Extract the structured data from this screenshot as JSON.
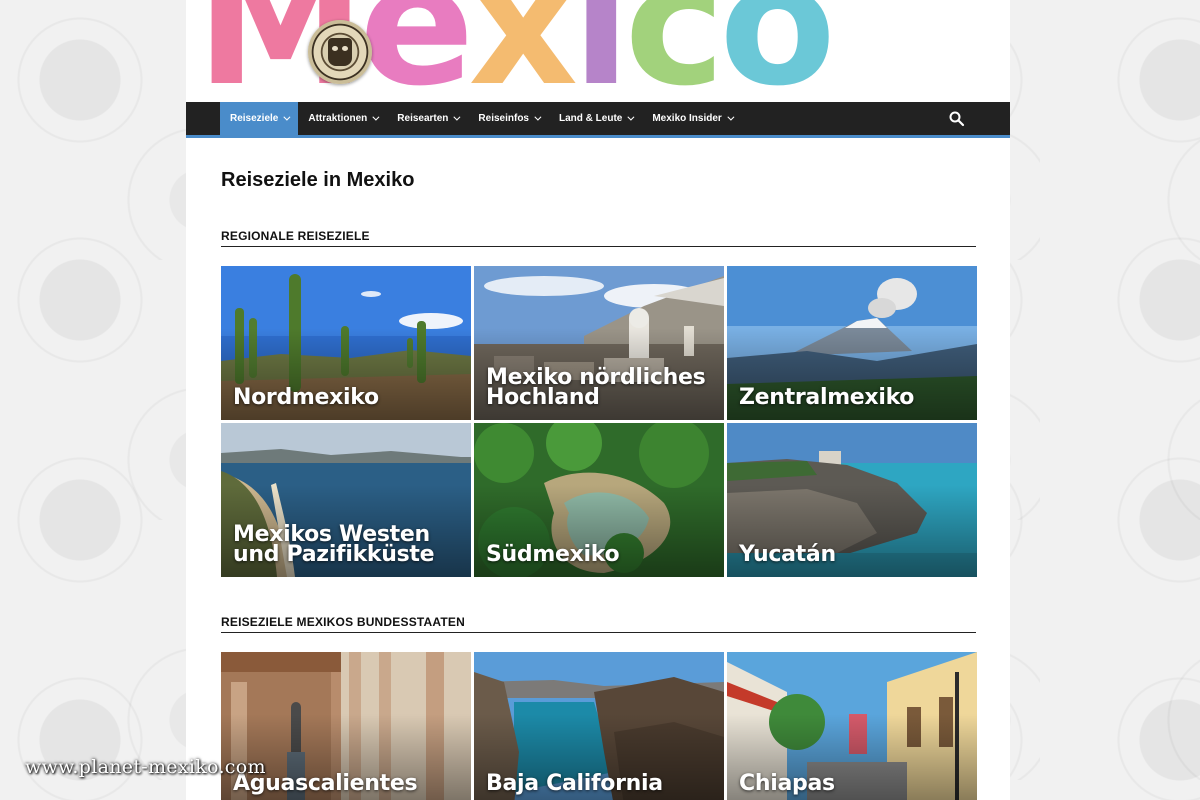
{
  "header": {
    "logo_letters": [
      "M",
      "e",
      "x",
      "i",
      "c",
      "o"
    ],
    "logo_colors": [
      "#e8467c",
      "#e04aa8",
      "#f0a13a",
      "#9a55b5",
      "#7fc24a",
      "#33b3c9"
    ]
  },
  "nav": {
    "items": [
      {
        "label": "Reiseziele",
        "active": true
      },
      {
        "label": "Attraktionen",
        "active": false
      },
      {
        "label": "Reisearten",
        "active": false
      },
      {
        "label": "Reiseinfos",
        "active": false
      },
      {
        "label": "Land & Leute",
        "active": false
      },
      {
        "label": "Mexiko Insider",
        "active": false
      }
    ],
    "accent": "#4a8cca"
  },
  "main": {
    "title": "Reiseziele in Mexiko",
    "sections": [
      {
        "heading": "REGIONALE REISEZIELE",
        "tiles": [
          {
            "label": "Nordmexiko",
            "scene": "desert-cactus"
          },
          {
            "label": "Mexiko nördliches Hochland",
            "scene": "colonial-town"
          },
          {
            "label": "Zentralmexiko",
            "scene": "volcano"
          },
          {
            "label": "Mexikos Westen und Pazifikküste",
            "scene": "coast-bay"
          },
          {
            "label": "Südmexiko",
            "scene": "jungle-river"
          },
          {
            "label": "Yucatán",
            "scene": "cliff-ruins"
          }
        ]
      },
      {
        "heading": "REISEZIELE MEXIKOS BUNDESSTAATEN",
        "tiles": [
          {
            "label": "Aguascalientes",
            "scene": "arcade"
          },
          {
            "label": "Baja California",
            "scene": "lagoon"
          },
          {
            "label": "Chiapas",
            "scene": "colorful-street"
          }
        ]
      }
    ]
  },
  "watermark": "www.planet-mexiko.com"
}
